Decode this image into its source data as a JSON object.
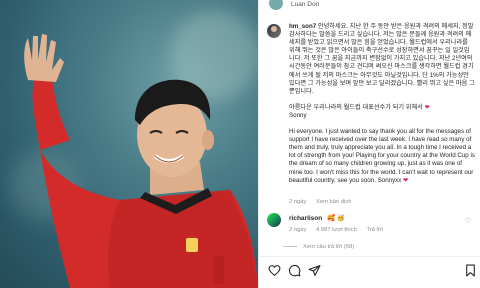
{
  "post": {
    "top_name": "Luan Don",
    "username": "hm_son7",
    "korean_1": "안녕하세요. 지난 한 주 동안 받은 응원과 격려의 메세지, 정말 감사하다는 말씀을 드리고 싶습니다. 저는 많은 분들께 응원과 격려의 메세지를 받았고 읽으면서 많은 힘을 얻었습니다. 월드컵에서 우리나라를 위해 뛰는 것은 많은 아이들이 축구선수로 성장하면서 꿈꾸는 일 일것입니다. 저 또한 그 꿈을 지금까지 변함없이 가지고 있습니다. 지난 2년여의 시간동안 여러분들이 참고 견디며 써오신 마스크를 생각하면 월드컵 경기에서 쓰게 될 저의 마스크는 아무것도 아닐것입니다. 단 1%의 가능성만 있다면 그 가능성을 보며 앞만 보고 달리겠습니다. 빨리 뛰고 싶은 마음 그뿐입니다.",
    "korean_2": "아름다운 우리나라의 월드컵 대표선수가 되기 위해서",
    "korean_sign": "Sonny",
    "english": "Hi everyone. I just wanted to say thank you all for the messages of support I have received over the last week. I have read so many of them and truly, truly appreciate you all. In a tough time I received a lot of strength from you! Playing for your country at the World Cup is the dream of so many children growing up, just as it was one of mine too. I won't miss this for the world. I can't wait to represent our beautiful country, see you soon. Sonnyxx",
    "time": "2 ngày",
    "see_translation": "Xem bản dịch"
  },
  "comment": {
    "username": "richarlison",
    "emojis": "🥰 🥳",
    "time": "2 ngày",
    "likes": "4.987 lượt thích",
    "reply": "Trả lời",
    "view_replies": "Xem câu trả lời (68)"
  },
  "colors": {
    "heart": "#e0245e",
    "photo_bg": "#3c6b78",
    "jersey": "#d32a2a"
  }
}
